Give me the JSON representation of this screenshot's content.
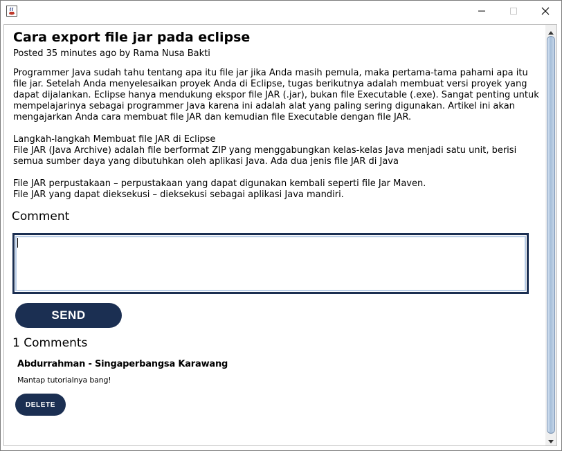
{
  "window": {
    "icon": "java-cup-icon",
    "controls": {
      "minimize": "minimize-icon",
      "maximize": "maximize-icon",
      "close": "close-icon"
    }
  },
  "article": {
    "title": "Cara export file jar pada eclipse",
    "meta": "Posted 35 minutes ago by Rama Nusa Bakti",
    "paragraphs": [
      "Programmer Java sudah tahu tentang apa itu file jar jika Anda masih pemula, maka pertama-tama pahami apa itu file jar. Setelah Anda menyelesaikan proyek Anda di Eclipse, tugas berikutnya adalah membuat versi proyek yang dapat dijalankan. Eclipse hanya mendukung ekspor file JAR (.jar), bukan file Executable (.exe). Sangat penting untuk mempelajarinya sebagai programmer Java karena ini adalah alat yang paling sering digunakan. Artikel ini akan mengajarkan Anda cara membuat file JAR dan kemudian file Executable dengan file JAR.",
      "Langkah-langkah Membuat file JAR di Eclipse",
      "File JAR (Java Archive) adalah file berformat ZIP yang menggabungkan kelas-kelas Java menjadi satu unit, berisi semua sumber daya yang dibutuhkan oleh aplikasi Java. Ada dua jenis file JAR di Java",
      "File JAR perpustakaan – perpustakaan yang dapat digunakan kembali seperti file Jar Maven.",
      "File JAR yang dapat dieksekusi – dieksekusi sebagai aplikasi Java mandiri."
    ]
  },
  "comment_form": {
    "label": "Comment",
    "value": "",
    "send_label": "SEND"
  },
  "comments": {
    "count_label": "1 Comments",
    "items": [
      {
        "author": "Abdurrahman - Singaperbangsa Karawang",
        "text": "Mantap tutorialnya bang!",
        "delete_label": "DELETE"
      }
    ]
  },
  "colors": {
    "accent": "#1b2f52",
    "input_focus": "#b8cce6",
    "scroll_thumb": "#a7bfd9"
  }
}
